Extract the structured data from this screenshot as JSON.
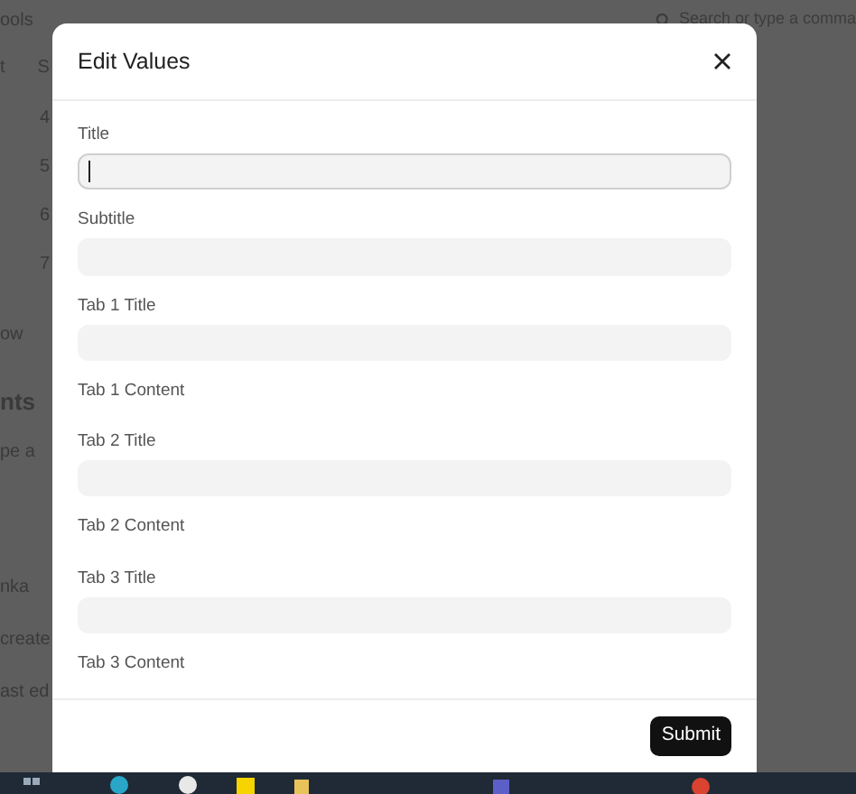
{
  "background": {
    "menu_text": "ools",
    "search_placeholder": "Search or type a comma",
    "column_heads": [
      "t",
      "S"
    ],
    "row_numbers": [
      "4",
      "5",
      "6",
      "7"
    ],
    "fragments": [
      {
        "kind": "link",
        "text": "ow"
      },
      {
        "kind": "heading",
        "text": "nts"
      },
      {
        "kind": "text",
        "text": "pe a"
      },
      {
        "kind": "text",
        "text": "nka"
      },
      {
        "kind": "text",
        "text": "create"
      },
      {
        "kind": "text",
        "text": "ast ed"
      }
    ]
  },
  "modal": {
    "title": "Edit Values",
    "fields": [
      {
        "label": "Title",
        "kind": "input",
        "focused": true
      },
      {
        "label": "Subtitle",
        "kind": "input",
        "focused": false
      },
      {
        "label": "Tab 1 Title",
        "kind": "input",
        "focused": false
      },
      {
        "label": "Tab 1 Content",
        "kind": "content"
      },
      {
        "label": "Tab 2 Title",
        "kind": "input",
        "focused": false
      },
      {
        "label": "Tab 2 Content",
        "kind": "content"
      },
      {
        "label": "Tab 3 Title",
        "kind": "input",
        "focused": false
      },
      {
        "label": "Tab 3 Content",
        "kind": "content"
      }
    ],
    "submit": "Submit"
  }
}
